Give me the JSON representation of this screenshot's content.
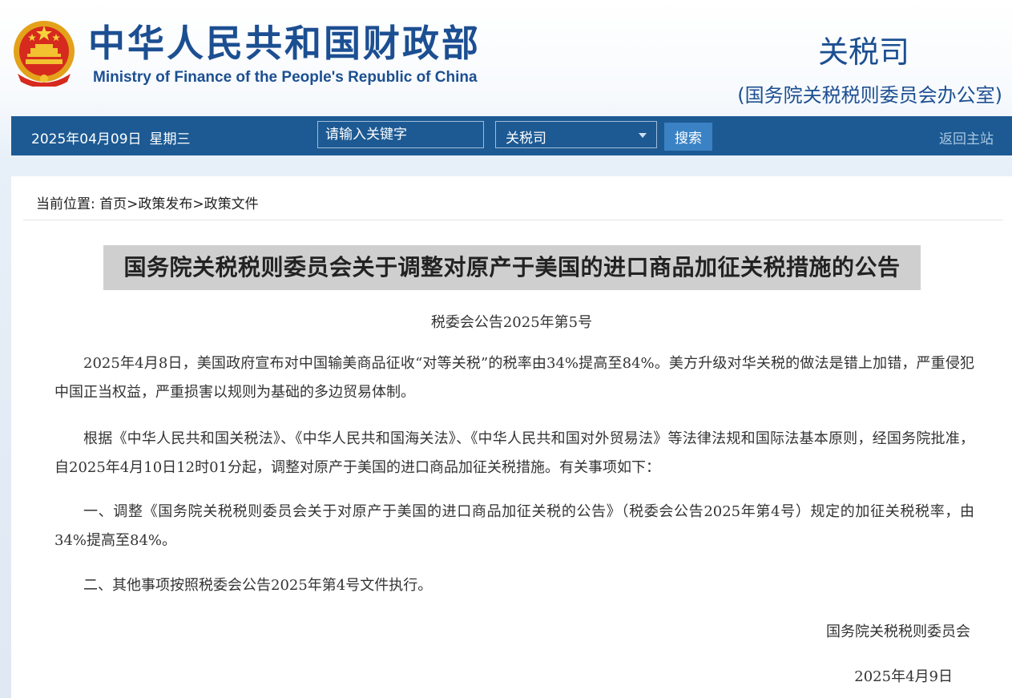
{
  "header": {
    "cn_title": "中华人民共和国财政部",
    "en_title": "Ministry of Finance of the People's Republic of China",
    "department": "关税司",
    "department_sub": "(国务院关税税则委员会办公室)"
  },
  "nav": {
    "date": "2025年04月09日",
    "weekday": "星期三",
    "search_placeholder": "请输入关键字",
    "scope_selected": "关税司",
    "search_button": "搜索",
    "home_link": "返回主站"
  },
  "breadcrumb": {
    "prefix": "当前位置:",
    "items": [
      "首页",
      "政策发布",
      "政策文件"
    ],
    "separator": ">"
  },
  "article": {
    "title": "国务院关税税则委员会关于调整对原产于美国的进口商品加征关税措施的公告",
    "number": "税委会公告2025年第5号",
    "paragraphs": [
      "2025年4月8日，美国政府宣布对中国输美商品征收“对等关税”的税率由34%提高至84%。美方升级对华关税的做法是错上加错，严重侵犯中国正当权益，严重损害以规则为基础的多边贸易体制。",
      "根据《中华人民共和国关税法》、《中华人民共和国海关法》、《中华人民共和国对外贸易法》等法律法规和国际法基本原则，经国务院批准，自2025年4月10日12时01分起，调整对原产于美国的进口商品加征关税措施。有关事项如下：",
      "一、调整《国务院关税税则委员会关于对原产于美国的进口商品加征关税的公告》（税委会公告2025年第4号）规定的加征关税税率，由34%提高至84%。",
      "二、其他事项按照税委会公告2025年第4号文件执行。"
    ],
    "signature": "国务院关税税则委员会",
    "sign_date": "2025年4月9日"
  },
  "colors": {
    "brand_blue": "#1c4f92",
    "navbar": "#1d5a93",
    "search_button": "#3a82c4",
    "title_highlight": "#cfcfcf"
  },
  "icons": {
    "emblem": "national-emblem-icon",
    "dropdown": "chevron-down-icon"
  }
}
